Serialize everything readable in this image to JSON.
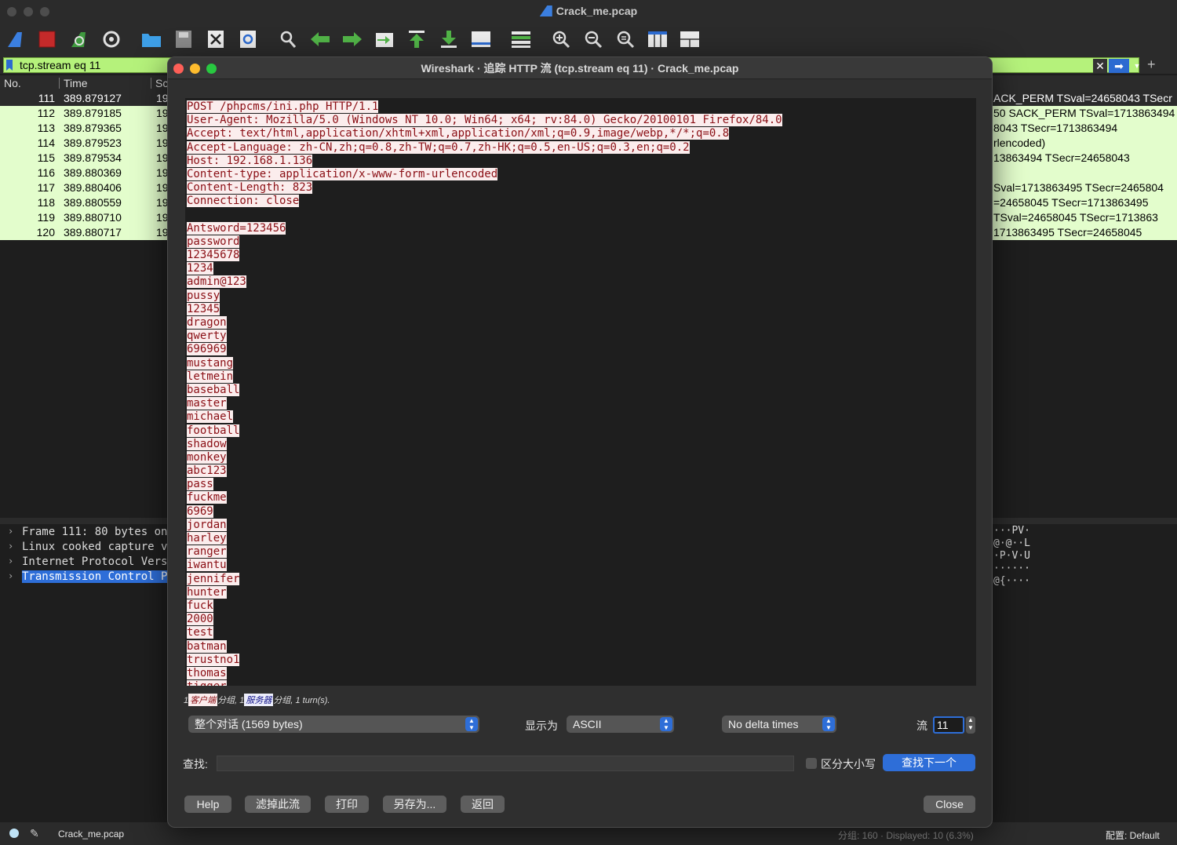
{
  "main_window": {
    "title": "Crack_me.pcap",
    "filter": "tcp.stream eq 11"
  },
  "toolbar_icons": [
    "shark-fin-start-icon",
    "stop-capture-icon",
    "restart-capture-icon",
    "capture-options-icon",
    "open-file-icon",
    "save-file-icon",
    "close-file-icon",
    "reload-icon",
    "find-packet-icon",
    "go-back-icon",
    "go-forward-icon",
    "go-to-packet-icon",
    "go-first-icon",
    "go-last-icon",
    "autoscroll-icon",
    "colorize-icon",
    "zoom-in-icon",
    "zoom-out-icon",
    "zoom-normal-icon",
    "resize-columns-icon",
    "expand-layout-icon"
  ],
  "packet_list": {
    "headers": {
      "no": "No.",
      "time": "Time",
      "source": "Sc"
    },
    "rows": [
      {
        "no": "111",
        "time": "389.879127",
        "src": "19",
        "info": "ACK_PERM TSval=24658043 TSecr"
      },
      {
        "no": "112",
        "time": "389.879185",
        "src": "19",
        "info": "50 SACK_PERM TSval=1713863494"
      },
      {
        "no": "113",
        "time": "389.879365",
        "src": "19",
        "info": "8043 TSecr=1713863494"
      },
      {
        "no": "114",
        "time": "389.879523",
        "src": "19",
        "info": "rlencoded)"
      },
      {
        "no": "115",
        "time": "389.879534",
        "src": "19",
        "info": "13863494 TSecr=24658043"
      },
      {
        "no": "116",
        "time": "389.880369",
        "src": "19",
        "info": ""
      },
      {
        "no": "117",
        "time": "389.880406",
        "src": "19",
        "info": "Sval=1713863495 TSecr=2465804"
      },
      {
        "no": "118",
        "time": "389.880559",
        "src": "19",
        "info": "=24658045 TSecr=1713863495"
      },
      {
        "no": "119",
        "time": "389.880710",
        "src": "19",
        "info": "TSval=24658045 TSecr=1713863"
      },
      {
        "no": "120",
        "time": "389.880717",
        "src": "19",
        "info": "1713863495 TSecr=24658045"
      }
    ]
  },
  "packet_details": [
    "Frame 111: 80 bytes on",
    "Linux cooked capture v",
    "Internet Protocol Vers",
    "Transmission Control P"
  ],
  "bytes_pane": [
    "···PV·",
    "@·@··L",
    "·P·V·U",
    "······",
    "@{····"
  ],
  "status_bar": {
    "file": "Crack_me.pcap",
    "counts": "分组: 160 · Displayed: 10 (6.3%)",
    "profile": "配置: Default"
  },
  "dialog": {
    "title": "Wireshark · 追踪 HTTP 流 (tcp.stream eq 11) · Crack_me.pcap",
    "stream_lines": [
      "POST /phpcms/ini.php HTTP/1.1",
      "User-Agent: Mozilla/5.0 (Windows NT 10.0; Win64; x64; rv:84.0) Gecko/20100101 Firefox/84.0",
      "Accept: text/html,application/xhtml+xml,application/xml;q=0.9,image/webp,*/*;q=0.8",
      "Accept-Language: zh-CN,zh;q=0.8,zh-TW;q=0.7,zh-HK;q=0.5,en-US;q=0.3,en;q=0.2",
      "Host: 192.168.1.136",
      "Content-type: application/x-www-form-urlencoded",
      "Content-Length: 823",
      "Connection: close",
      "",
      "Antsword=123456",
      "password",
      "12345678",
      "1234",
      "admin@123",
      "pussy",
      "12345",
      "dragon",
      "qwerty",
      "696969",
      "mustang",
      "letmein",
      "baseball",
      "master",
      "michael",
      "football",
      "shadow",
      "monkey",
      "abc123",
      "pass",
      "fuckme",
      "6969",
      "jordan",
      "harley",
      "ranger",
      "iwantu",
      "jennifer",
      "hunter",
      "fuck",
      "2000",
      "test",
      "batman",
      "trustno1",
      "thomas",
      "tigger"
    ],
    "turn_summary": {
      "client_count": "1",
      "client_label": "客户端",
      "mid1": "分组,",
      "server_count": "1",
      "server_label": "服务器",
      "mid2": "分组,",
      "turns": "1 turn(s)."
    },
    "conversation_select": "整个对话 (1569 bytes)",
    "show_as_label": "显示为",
    "show_as_value": "ASCII",
    "delta_select": "No delta times",
    "stream_label": "流",
    "stream_value": "11",
    "find_label": "查找:",
    "find_value": "",
    "case_label": "区分大小写",
    "find_next": "查找下一个",
    "buttons": {
      "help": "Help",
      "filter_out": "滤掉此流",
      "print": "打印",
      "save_as": "另存为...",
      "back": "返回",
      "close": "Close"
    }
  }
}
